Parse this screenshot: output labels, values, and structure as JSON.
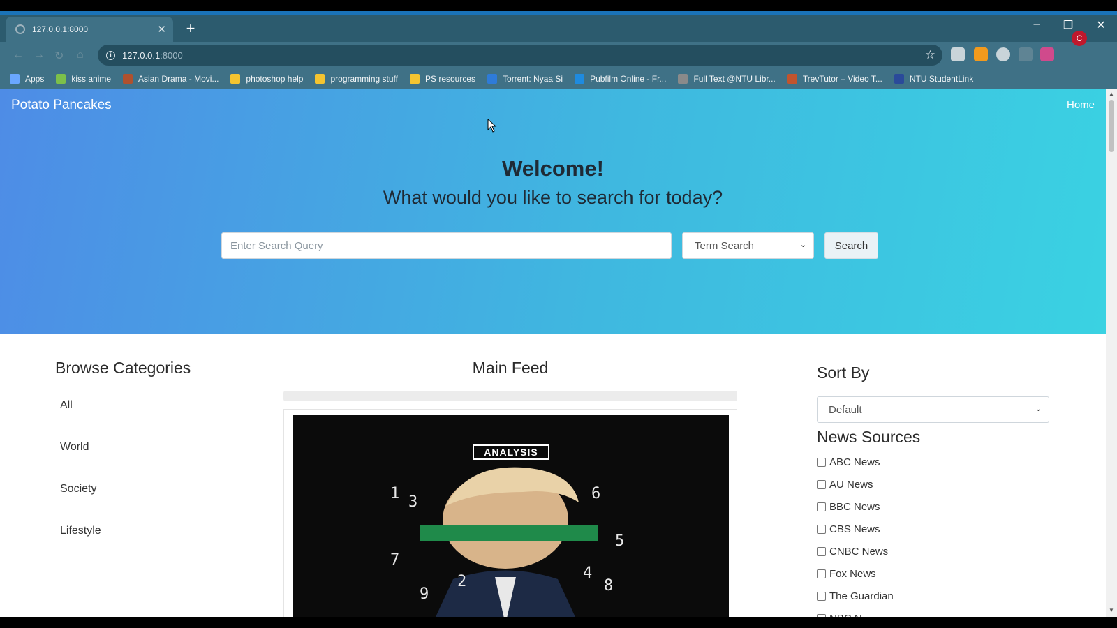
{
  "browser": {
    "tab_title": "127.0.0.1:8000",
    "tab_close": "✕",
    "new_tab": "+",
    "window": {
      "minimize": "–",
      "restore": "❐",
      "close": "✕"
    },
    "url_host": "127.0.0.1",
    "url_port": ":8000",
    "star": "☆",
    "profile_initial": "C",
    "bookmarks": [
      {
        "label": "Apps",
        "color": "#6aa7ff"
      },
      {
        "label": "kiss anime",
        "color": "#7cc04a"
      },
      {
        "label": "Asian Drama - Movi...",
        "color": "#b0512e"
      },
      {
        "label": "photoshop help",
        "color": "#f4c430"
      },
      {
        "label": "programming stuff",
        "color": "#f4c430"
      },
      {
        "label": "PS resources",
        "color": "#f4c430"
      },
      {
        "label": "Torrent: Nyaa Si",
        "color": "#2e7bd8"
      },
      {
        "label": "Pubfilm Online - Fr...",
        "color": "#1e8be0"
      },
      {
        "label": "Full Text @NTU Libr...",
        "color": "#8a8a8a"
      },
      {
        "label": "TrevTutor – Video T...",
        "color": "#c2542d"
      },
      {
        "label": "NTU StudentLink",
        "color": "#2a4a9a"
      }
    ]
  },
  "site": {
    "brand": "Potato Pancakes",
    "nav_home": "Home",
    "welcome": "Welcome!",
    "subtitle": "What would you like to search for today?",
    "search": {
      "placeholder": "Enter Search Query",
      "mode": "Term Search",
      "button": "Search"
    },
    "categories": {
      "title": "Browse Categories",
      "items": [
        "All",
        "World",
        "Society",
        "Lifestyle"
      ]
    },
    "feed": {
      "title": "Main Feed",
      "image_badge": "ANALYSIS",
      "image_numbers": [
        "1",
        "3",
        "6",
        "5",
        "7",
        "2",
        "4",
        "8",
        "9"
      ]
    },
    "sort": {
      "title": "Sort By",
      "selected": "Default"
    },
    "sources": {
      "title": "News Sources",
      "items": [
        "ABC News",
        "AU News",
        "BBC News",
        "CBS News",
        "CNBC News",
        "Fox News",
        "The Guardian",
        "NBC N..."
      ]
    }
  },
  "colors": {
    "hero_start": "#4e8ce6",
    "hero_end": "#3ad2e2",
    "chrome": "#3f7186"
  }
}
